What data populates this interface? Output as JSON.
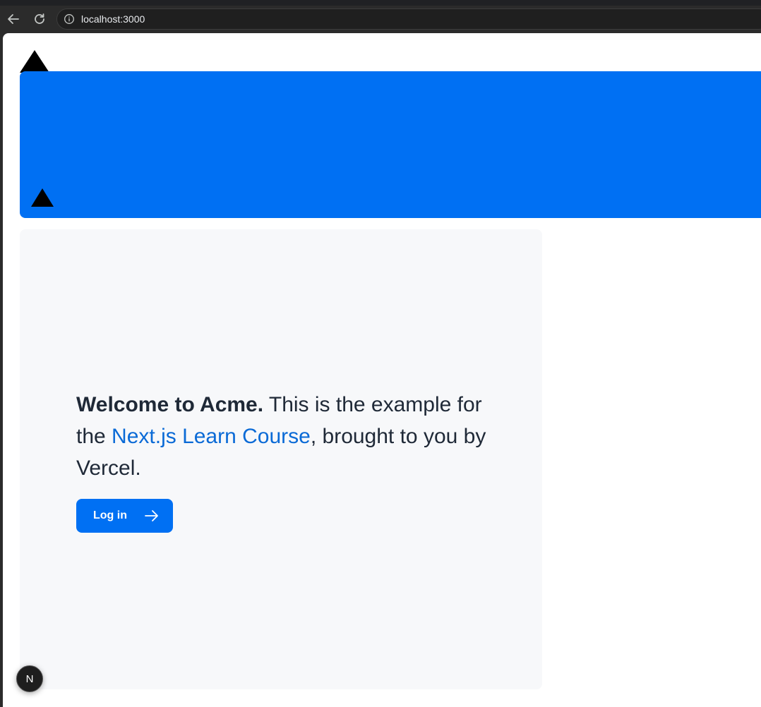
{
  "browser": {
    "url": "localhost:3000"
  },
  "welcome": {
    "strong_text": "Welcome to Acme.",
    "text_before_link": " This is the example for the ",
    "link_text": "Next.js Learn Course",
    "text_after_link": ", brought to you by Vercel."
  },
  "login_button": {
    "label": "Log in"
  },
  "next_badge": {
    "label": "N"
  },
  "colors": {
    "brand_blue": "#0070f3",
    "link_blue": "#0a6ad6",
    "card_bg": "#f7f8fa",
    "text_dark": "#1f2937"
  },
  "icons": {
    "back": "arrow-left-icon",
    "reload": "reload-icon",
    "info": "info-icon",
    "logo": "triangle-logo-icon",
    "login_arrow": "arrow-right-icon"
  }
}
